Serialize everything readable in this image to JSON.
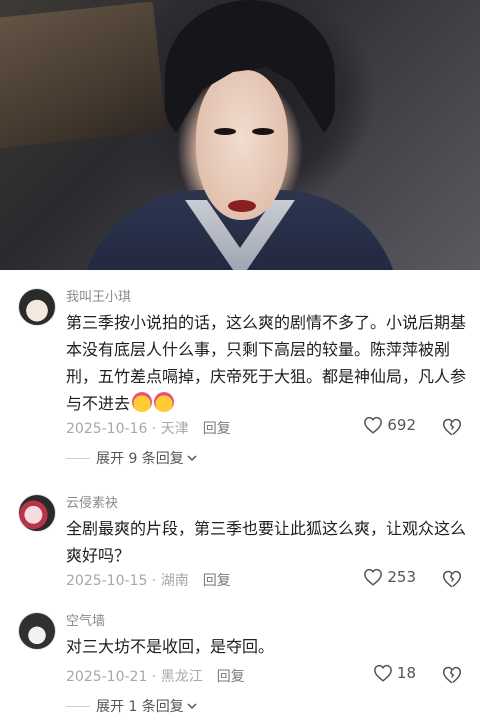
{
  "comments": [
    {
      "username": "我叫王小琪",
      "text": "第三季按小说拍的话，这么爽的剧情不多了。小说后期基本没有底层人什么事，只剩下高层的较量。陈萍萍被剐刑，五竹差点嗝掉，庆帝死于大狙。都是神仙局，凡人参与不进去",
      "date_location": "2025-10-16 · 天津",
      "reply_label": "回复",
      "likes": "692",
      "expand_label": "展开 9 条回复"
    },
    {
      "username": "云侵素袂",
      "text": "全剧最爽的片段，第三季也要让此狐这么爽，让观众这么爽好吗？",
      "date_location": "2025-10-15 · 湖南",
      "reply_label": "回复",
      "likes": "253"
    },
    {
      "username": "空气墙",
      "text": "对三大坊不是收回，是夺回。",
      "date_location": "2025-10-21 · 黑龙江",
      "reply_label": "回复",
      "likes": "18",
      "expand_label": "展开 1 条回复"
    }
  ],
  "icons": {
    "like": "heart-outline-icon",
    "dislike": "broken-heart-icon",
    "expand": "chevron-down-icon"
  },
  "colors": {
    "username": "#8a8a8a",
    "meta": "#a8a8a8",
    "text": "#1f1f1f"
  }
}
